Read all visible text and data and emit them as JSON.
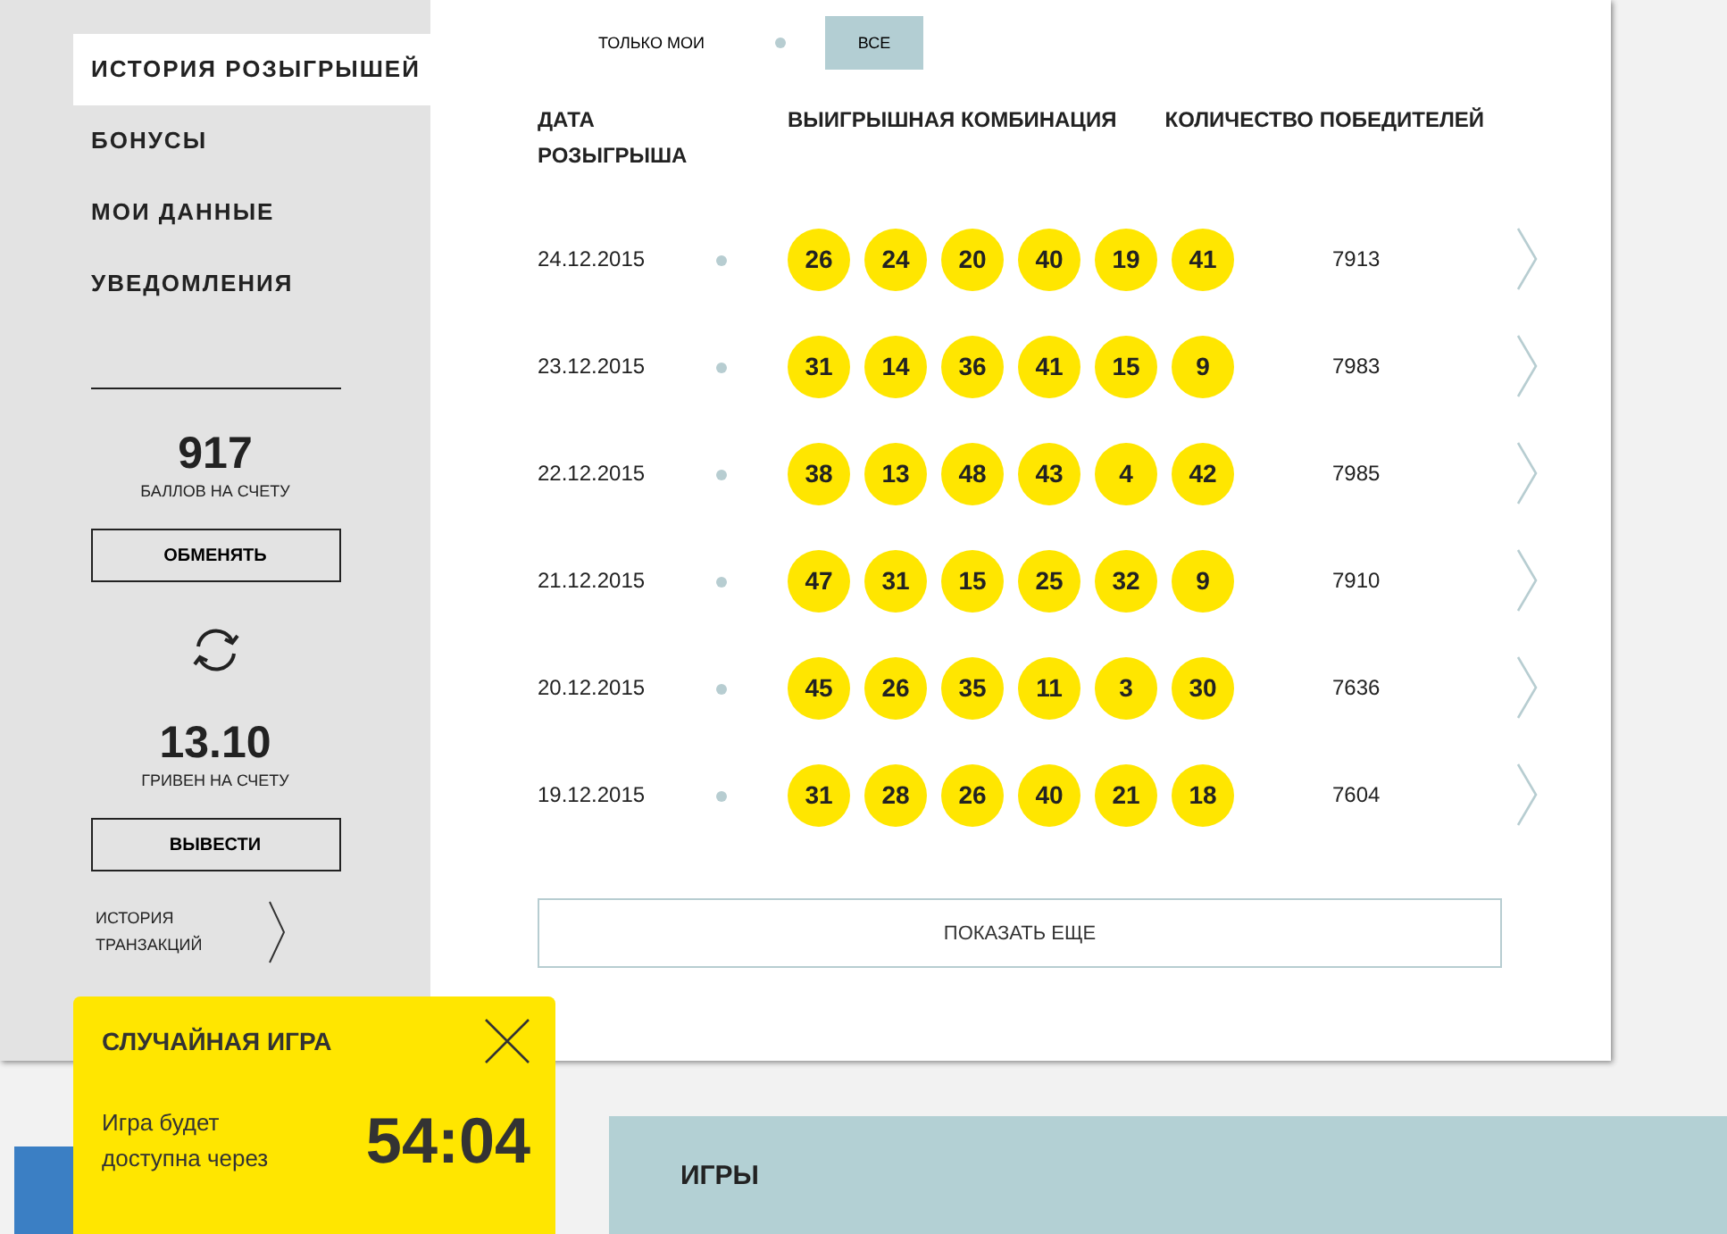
{
  "sidebar": {
    "items": [
      {
        "label": "ИСТОРИЯ РОЗЫГРЫШЕЙ",
        "selected": true
      },
      {
        "label": "БОНУСЫ",
        "selected": false
      },
      {
        "label": "МОИ ДАННЫЕ",
        "selected": false
      },
      {
        "label": "УВЕДОМЛЕНИЯ",
        "selected": false
      }
    ],
    "points": {
      "value": "917",
      "label": "БАЛЛОВ НА СЧЕТУ",
      "button": "ОБМЕНЯТЬ"
    },
    "money": {
      "value": "13.10",
      "label": "ГРИВЕН НА СЧЕТУ",
      "button": "ВЫВЕСТИ"
    },
    "history_link": "ИСТОРИЯ ТРАНЗАКЦИЙ"
  },
  "filter": [
    {
      "label": "ТОЛЬКО МОИ",
      "selected": false
    },
    {
      "label": "ВСЕ",
      "selected": true
    }
  ],
  "table": {
    "columns": [
      "ДАТА РОЗЫГРЫША",
      "ВЫИГРЫШНАЯ КОМБИНАЦИЯ",
      "КОЛИЧЕСТВО ПОБЕДИТЕЛЕЙ"
    ],
    "rows": [
      {
        "date": "24.12.2015",
        "numbers": [
          "26",
          "24",
          "20",
          "40",
          "19",
          "41"
        ],
        "winners": "7913"
      },
      {
        "date": "23.12.2015",
        "numbers": [
          "31",
          "14",
          "36",
          "41",
          "15",
          "9"
        ],
        "winners": "7983"
      },
      {
        "date": "22.12.2015",
        "numbers": [
          "38",
          "13",
          "48",
          "43",
          "4",
          "42"
        ],
        "winners": "7985"
      },
      {
        "date": "21.12.2015",
        "numbers": [
          "47",
          "31",
          "15",
          "25",
          "32",
          "9"
        ],
        "winners": "7910"
      },
      {
        "date": "20.12.2015",
        "numbers": [
          "45",
          "26",
          "35",
          "11",
          "3",
          "30"
        ],
        "winners": "7636"
      },
      {
        "date": "19.12.2015",
        "numbers": [
          "31",
          "28",
          "26",
          "40",
          "21",
          "18"
        ],
        "winners": "7604"
      }
    ]
  },
  "show_more": "ПОКАЗАТЬ ЕЩЕ",
  "popup": {
    "title": "СЛУЧАЙНАЯ ИГРА",
    "text": "Игра будет доступна через",
    "timer": "54:04"
  },
  "games_bar": "ИГРЫ"
}
